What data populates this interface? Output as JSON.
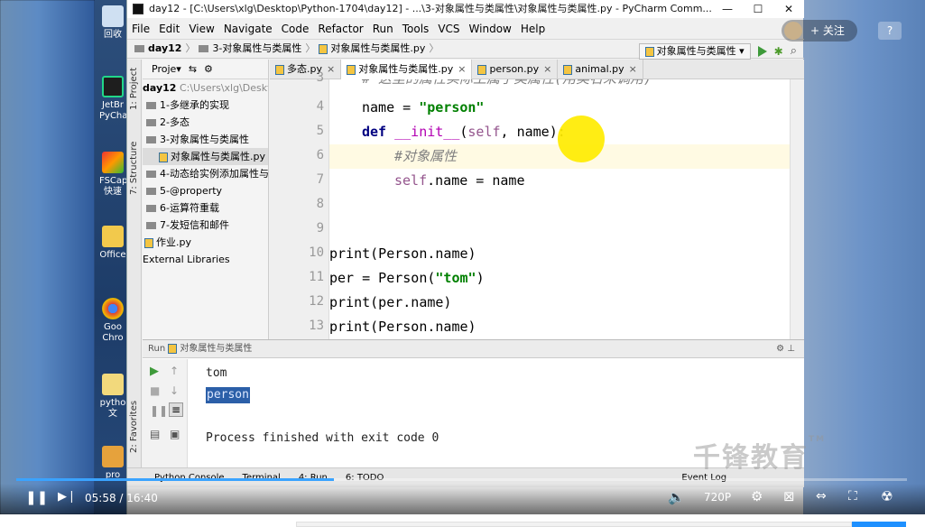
{
  "window": {
    "title": "day12 - [C:\\Users\\xlg\\Desktop\\Python-1704\\day12] - ...\\3-对象属性与类属性\\对象属性与类属性.py - PyCharm Comm...",
    "controls": [
      "—",
      "☐",
      "✕"
    ]
  },
  "menu": [
    "File",
    "Edit",
    "View",
    "Navigate",
    "Code",
    "Refactor",
    "Run",
    "Tools",
    "VCS",
    "Window",
    "Help"
  ],
  "breadcrumb": [
    "day12",
    "3-对象属性与类属性",
    "对象属性与类属性.py"
  ],
  "run_config": "对象属性与类属性",
  "tool_windows": {
    "project": "1: Project",
    "structure": "7: Structure",
    "favorites": "2: Favorites"
  },
  "project": {
    "header": "Proje",
    "root_name": "day12",
    "root_path": "C:\\Users\\xlg\\Deskto",
    "items": [
      {
        "label": "1-多继承的实现",
        "type": "folder"
      },
      {
        "label": "2-多态",
        "type": "folder"
      },
      {
        "label": "3-对象属性与类属性",
        "type": "folder"
      },
      {
        "label": "对象属性与类属性.py",
        "type": "file",
        "selected": true
      },
      {
        "label": "4-动态给实例添加属性与方",
        "type": "folder"
      },
      {
        "label": "5-@property",
        "type": "folder"
      },
      {
        "label": "6-运算符重载",
        "type": "folder"
      },
      {
        "label": "7-发短信和邮件",
        "type": "folder"
      },
      {
        "label": "作业.py",
        "type": "file"
      },
      {
        "label": "External Libraries",
        "type": "lib"
      }
    ]
  },
  "tabs": [
    {
      "label": "多态.py",
      "active": false
    },
    {
      "label": "对象属性与类属性.py",
      "active": true
    },
    {
      "label": "person.py",
      "active": false
    },
    {
      "label": "animal.py",
      "active": false
    }
  ],
  "code_lines": [
    {
      "num": "3",
      "text": "# 这里的属性实际上属于类属性(用类名来调用)"
    },
    {
      "num": "4",
      "text": "name = \"person\""
    },
    {
      "num": "5",
      "text": "def __init__(self, name):"
    },
    {
      "num": "6",
      "text": "#对象属性"
    },
    {
      "num": "7",
      "text": "self.name = name"
    },
    {
      "num": "8",
      "text": ""
    },
    {
      "num": "9",
      "text": ""
    },
    {
      "num": "10",
      "text": "print(Person.name)"
    },
    {
      "num": "11",
      "text": "per = Person(\"tom\")"
    },
    {
      "num": "12",
      "text": "print(per.name)"
    },
    {
      "num": "13",
      "text": "print(Person.name)"
    }
  ],
  "run": {
    "header": "Run",
    "config": "对象属性与类属性",
    "output": [
      "tom",
      "person",
      "Process finished with exit code 0"
    ]
  },
  "bottom_tools": [
    "Python Console",
    "Terminal",
    "4: Run",
    "6: TODO",
    "Event Log"
  ],
  "player": {
    "time": "05:58 / 16:40",
    "quality": "720P",
    "progress": 0.357,
    "follow": "+ 关注",
    "help": "?",
    "watermark": "千锋教育",
    "watermark_tm": "TM"
  },
  "desktop_icons": [
    "回收",
    "JetBr PyCha",
    "FSCap 快速",
    "Office",
    "Goo Chro",
    "pytho 文",
    "pro"
  ]
}
